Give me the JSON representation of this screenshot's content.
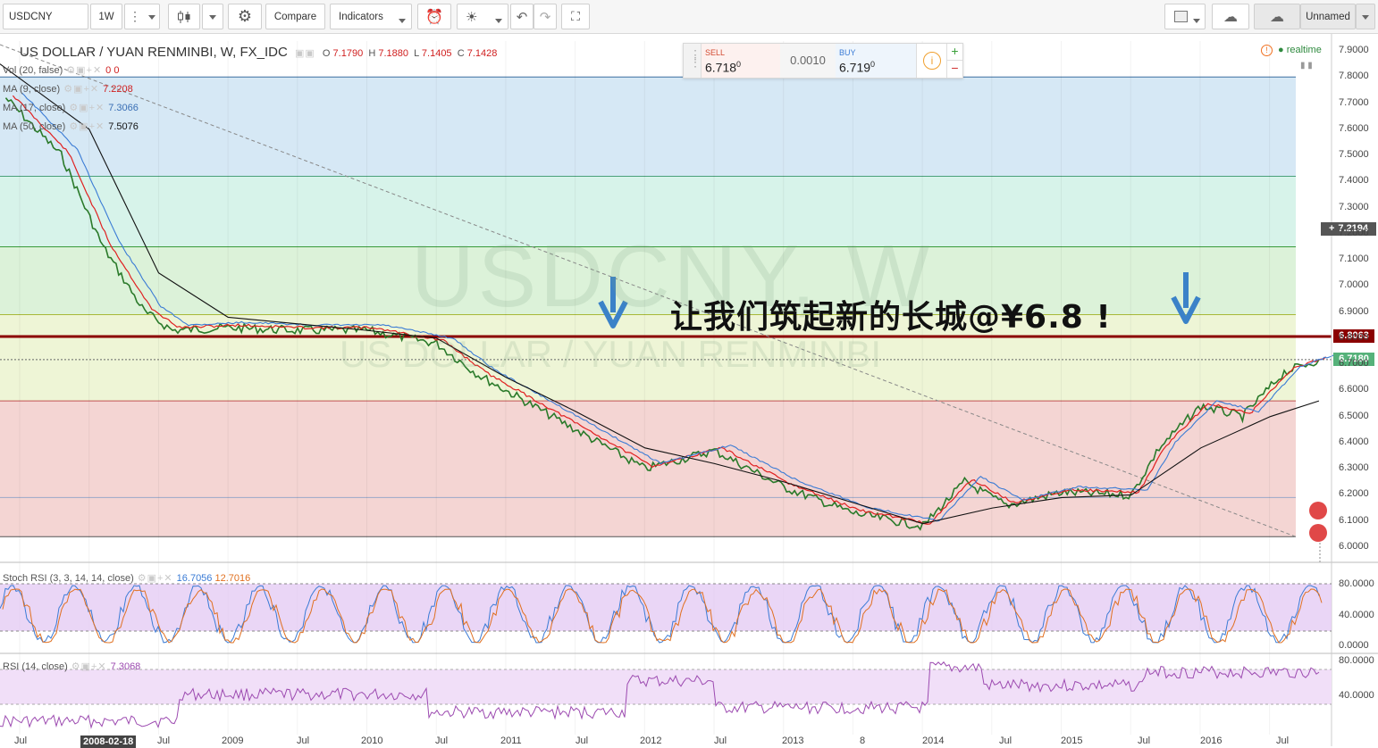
{
  "toolbar": {
    "symbol": "USDCNY",
    "interval": "1W",
    "compare": "Compare",
    "indicators": "Indicators",
    "layout_name": "Unnamed"
  },
  "header": {
    "title": "US DOLLAR / YUAN RENMINBI, W, FX_IDC",
    "o_label": "O",
    "o_value": "7.1790",
    "h_label": "H",
    "h_value": "7.1880",
    "l_label": "L",
    "l_value": "7.1405",
    "c_label": "C",
    "c_value": "7.1428",
    "realtime": "realtime"
  },
  "legends": {
    "vol": "Vol (20, false)",
    "vol_values": "0 0",
    "ma9": "MA (9, close)",
    "ma9_value": "7.2208",
    "ma17": "MA (17, close)",
    "ma17_value": "7.3066",
    "ma50": "MA (50, close)",
    "ma50_value": "7.5076",
    "stoch": "Stoch RSI (3, 3, 14, 14, close)",
    "stoch_k": "16.7056",
    "stoch_d": "12.7016",
    "rsi": "RSI (14, close)",
    "rsi_value": "7.3068"
  },
  "trade": {
    "sell_label": "SELL",
    "sell_value": "6.718",
    "sell_sup": "0",
    "spread": "0.0010",
    "buy_label": "BUY",
    "buy_value": "6.719",
    "buy_sup": "0"
  },
  "watermark": {
    "main": "USDCNY, W",
    "sub": "US DOLLAR / YUAN RENMINBI"
  },
  "annotation": "让我们筑起新的长城@¥6.8 !",
  "price_labels": {
    "cursor": "7.2194",
    "level": "6.8063",
    "last": "6.7180"
  },
  "price_axis": [
    "7.9000",
    "7.8000",
    "7.7000",
    "7.6000",
    "7.5000",
    "7.4000",
    "7.3000",
    "7.2000",
    "7.1000",
    "7.0000",
    "6.9000",
    "6.8000",
    "6.7000",
    "6.6000",
    "6.5000",
    "6.4000",
    "6.3000",
    "6.2000",
    "6.1000",
    "6.0000"
  ],
  "stoch_axis": [
    "80.0000",
    "40.0000",
    "0.0000"
  ],
  "rsi_axis": [
    "80.0000",
    "40.0000"
  ],
  "time_axis": [
    "Jul",
    "2008-02-18",
    "Jul",
    "2009",
    "Jul",
    "2010",
    "Jul",
    "2011",
    "Jul",
    "2012",
    "Jul",
    "2013",
    "8",
    "2014",
    "Jul",
    "2015",
    "Jul",
    "2016",
    "Jul"
  ],
  "colors": {
    "zone_blue": "#d6e8f5",
    "zone_cyan": "#d7f3ea",
    "zone_green": "#dcf2d9",
    "zone_yellow": "#eef5d6",
    "zone_red": "#f4d5d3",
    "level_line": "#8b0000",
    "ma9": "#e02020",
    "ma17": "#3a7bd5",
    "ma50": "#111111",
    "stoch_bg": "#e3c8f3"
  },
  "chart_data": {
    "type": "line",
    "title": "US DOLLAR / YUAN RENMINBI, W, FX_IDC",
    "ylim": [
      6.0,
      7.9
    ],
    "x": [
      2007.4,
      2007.8,
      2008.1,
      2008.4,
      2008.6,
      2009.0,
      2009.5,
      2010.0,
      2010.5,
      2010.8,
      2011.0,
      2011.5,
      2012.0,
      2012.5,
      2013.0,
      2013.5,
      2014.0,
      2014.3,
      2014.6,
      2015.0,
      2015.5,
      2015.7,
      2016.0,
      2016.3,
      2016.6,
      2016.85
    ],
    "series": [
      {
        "name": "close",
        "values": [
          7.72,
          7.5,
          7.15,
          6.9,
          6.83,
          6.84,
          6.83,
          6.83,
          6.78,
          6.66,
          6.6,
          6.45,
          6.3,
          6.37,
          6.23,
          6.13,
          6.08,
          6.25,
          6.16,
          6.21,
          6.2,
          6.38,
          6.54,
          6.5,
          6.67,
          6.718
        ]
      }
    ]
  }
}
